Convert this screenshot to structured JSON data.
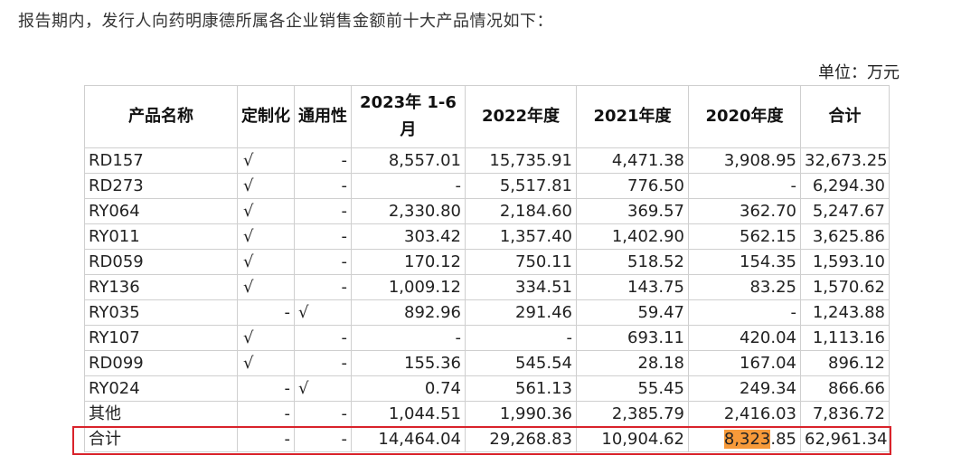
{
  "intro": "报告期内，发行人向药明康德所属各企业销售金额前十大产品情况如下：",
  "unit": "单位：万元",
  "headers": [
    "产品名称",
    "定制化",
    "通用性",
    "2023年 1-6月",
    "2022年度",
    "2021年度",
    "2020年度",
    "合计"
  ],
  "rows": [
    [
      "RD157",
      "√",
      "-",
      "8,557.01",
      "15,735.91",
      "4,471.38",
      "3,908.95",
      "32,673.25"
    ],
    [
      "RD273",
      "√",
      "-",
      "-",
      "5,517.81",
      "776.50",
      "-",
      "6,294.30"
    ],
    [
      "RY064",
      "√",
      "-",
      "2,330.80",
      "2,184.60",
      "369.57",
      "362.70",
      "5,247.67"
    ],
    [
      "RY011",
      "√",
      "-",
      "303.42",
      "1,357.40",
      "1,402.90",
      "562.15",
      "3,625.86"
    ],
    [
      "RD059",
      "√",
      "-",
      "170.12",
      "750.11",
      "518.52",
      "154.35",
      "1,593.10"
    ],
    [
      "RY136",
      "√",
      "-",
      "1,009.12",
      "334.51",
      "143.75",
      "83.25",
      "1,570.62"
    ],
    [
      "RY035",
      "-",
      "√",
      "892.96",
      "291.46",
      "59.47",
      "-",
      "1,243.88"
    ],
    [
      "RY107",
      "√",
      "-",
      "-",
      "-",
      "693.11",
      "420.04",
      "1,113.16"
    ],
    [
      "RD099",
      "√",
      "-",
      "155.36",
      "545.54",
      "28.18",
      "167.04",
      "896.12"
    ],
    [
      "RY024",
      "-",
      "√",
      "0.74",
      "561.13",
      "55.45",
      "249.34",
      "866.66"
    ],
    [
      "其他",
      "-",
      "-",
      "1,044.51",
      "1,990.36",
      "2,385.79",
      "2,416.03",
      "7,836.72"
    ]
  ],
  "total": {
    "name": "合计",
    "custom": "-",
    "general": "-",
    "h2023": "14,464.04",
    "y2022": "29,268.83",
    "y2021": "10,904.62",
    "y2020_hl": "8,323",
    "y2020_rest": ".85",
    "sum": "62,961.34"
  },
  "colors": {
    "highlight": "#f79a3a",
    "frame": "#d9232b"
  }
}
